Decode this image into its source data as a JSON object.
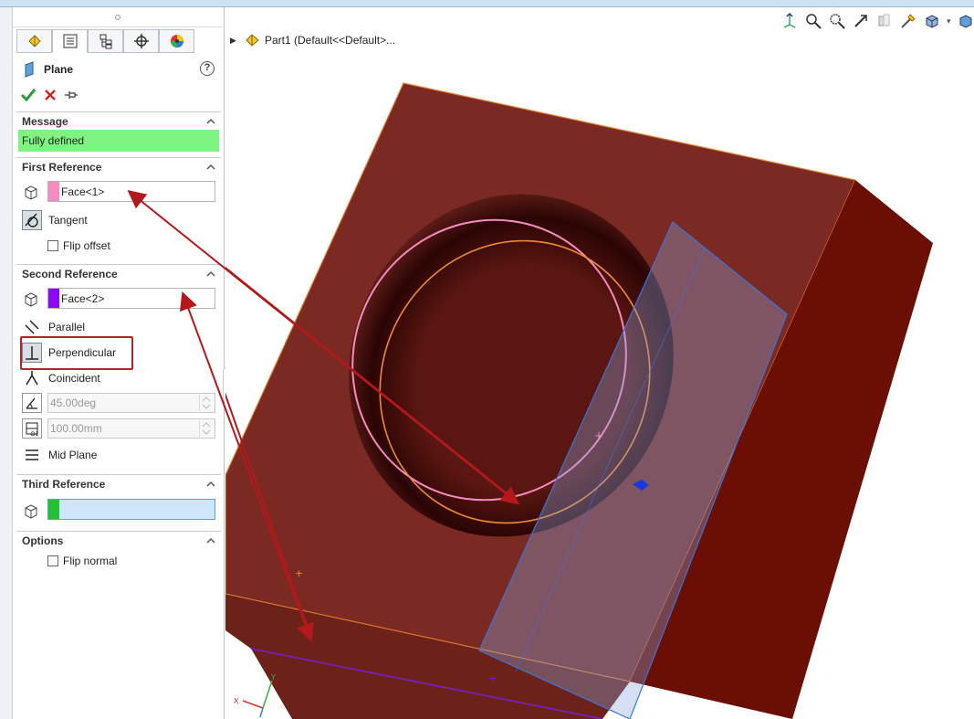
{
  "property_manager": {
    "title": "Plane",
    "help_label": "?",
    "message_section": {
      "header": "Message",
      "status": "Fully defined"
    },
    "first_reference": {
      "header": "First Reference",
      "selection": "Face<1>",
      "options": {
        "tangent": "Tangent",
        "flip_offset": "Flip offset"
      }
    },
    "second_reference": {
      "header": "Second Reference",
      "selection": "Face<2>",
      "options": {
        "parallel": "Parallel",
        "perpendicular": "Perpendicular",
        "coincident": "Coincident",
        "angle_value": "45.00deg",
        "distance_value": "100.00mm",
        "mid_plane": "Mid Plane"
      }
    },
    "third_reference": {
      "header": "Third Reference",
      "selection": ""
    },
    "options_section": {
      "header": "Options",
      "flip_normal": "Flip normal"
    }
  },
  "feature_tree": {
    "part_label": "Part1  (Default<<Default>..."
  },
  "colors": {
    "face1": "#f58bc0",
    "face2": "#8a0af5",
    "face3": "#22c32e",
    "status_ok": "#7ff37f",
    "part_face": "#7a2a22",
    "part_side": "#6b0e04",
    "annotation": "#b3181b"
  },
  "icons": {
    "tabs": [
      "feature-manager-icon",
      "property-manager-icon",
      "configuration-manager-icon",
      "dimxpert-icon",
      "display-manager-icon"
    ],
    "actions": [
      "ok-check-icon",
      "cancel-x-icon",
      "pushpin-icon"
    ],
    "view_toolbar": [
      "view-orientation-icon",
      "zoom-to-fit-icon",
      "zoom-area-icon",
      "previous-view-icon",
      "section-view-icon",
      "view-settings-icon",
      "display-style-icon"
    ]
  }
}
